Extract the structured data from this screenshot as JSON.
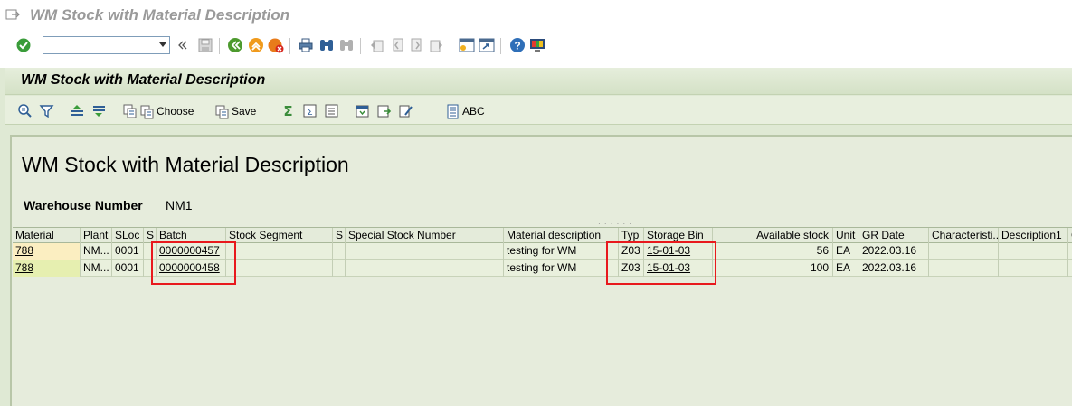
{
  "window": {
    "title": "WM Stock with Material Description"
  },
  "system_toolbar": {
    "command_field_value": "",
    "icons": [
      "enter-icon",
      "save-icon",
      "back-icon",
      "exit-icon",
      "cancel-icon",
      "print-icon",
      "find-icon",
      "find-next-icon",
      "first-page-icon",
      "previous-page-icon",
      "next-page-icon",
      "last-page-icon",
      "create-session-icon",
      "shortcut-icon",
      "help-icon",
      "customize-layout-icon"
    ]
  },
  "app": {
    "title": "WM Stock with Material Description",
    "toolbar": {
      "choose_label": "Choose",
      "save_label": "Save",
      "abc_label": "ABC"
    }
  },
  "report": {
    "title": "WM Stock with Material Description",
    "warehouse_label": "Warehouse Number",
    "warehouse_value": "NM1"
  },
  "grid": {
    "columns": [
      "Material",
      "Plant",
      "SLoc",
      "S",
      "Batch",
      "Stock Segment",
      "S",
      "Special Stock Number",
      "Material description",
      "Typ",
      "Storage Bin",
      "Available stock",
      "Unit",
      "GR Date",
      "Characteristi...",
      "Description1",
      "C"
    ],
    "rows": [
      {
        "material": "788",
        "plant": "NM...",
        "sloc": "0001",
        "s": "",
        "batch": "0000000457",
        "stock_segment": "",
        "s2": "",
        "special_stock": "",
        "description": "testing for WM",
        "typ": "Z03",
        "storage_bin": "15-01-03",
        "available_stock": "56",
        "unit": "EA",
        "gr_date": "2022.03.16",
        "characteristic": "",
        "description1": "",
        "c": ""
      },
      {
        "material": "788",
        "plant": "NM...",
        "sloc": "0001",
        "s": "",
        "batch": "0000000458",
        "stock_segment": "",
        "s2": "",
        "special_stock": "",
        "description": "testing for WM",
        "typ": "Z03",
        "storage_bin": "15-01-03",
        "available_stock": "100",
        "unit": "EA",
        "gr_date": "2022.03.16",
        "characteristic": "",
        "description1": "",
        "c": ""
      }
    ]
  },
  "colors": {
    "highlight_box": "#e8191d",
    "app_background": "#dfe9d4"
  }
}
